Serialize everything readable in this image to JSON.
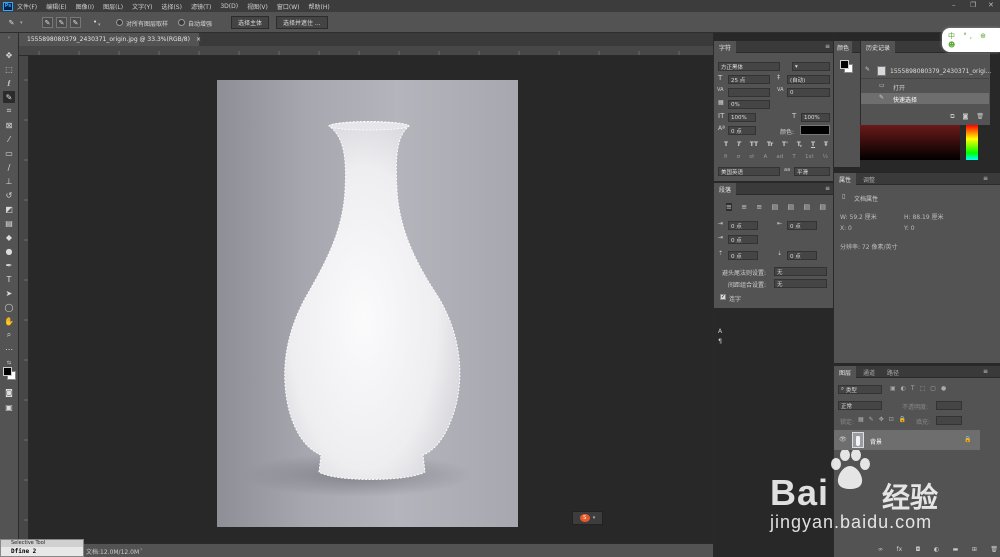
{
  "menu": {
    "logo": "Ps",
    "items": [
      "文件(F)",
      "编辑(E)",
      "图像(I)",
      "图层(L)",
      "文字(Y)",
      "选择(S)",
      "滤镜(T)",
      "3D(D)",
      "视图(V)",
      "窗口(W)",
      "帮助(H)"
    ]
  },
  "options": {
    "sample_all_layers": "对所有图层取样",
    "auto_enhance": "自动增强",
    "select_subject": "选择主体",
    "select_and_mask": "选择并遮住 ..."
  },
  "document": {
    "tab_title": "1555898080379_2430371_origin.jpg @ 33.3%(RGB/8)",
    "tab_close": "×"
  },
  "status": {
    "doc_size": "文档:12.0M/12.0M"
  },
  "character_panel": {
    "tab": "字符",
    "font_family": "方正黑体",
    "font_size": "25 点",
    "leading": "(自动)",
    "tracking": "0",
    "scale_pct": "0%",
    "v_scale": "100%",
    "h_scale": "100%",
    "baseline": "0 点",
    "color_label": "颜色:",
    "language": "美国英语",
    "antialias": "平滑",
    "style_buttons": [
      "T",
      "T",
      "TT",
      "Tr",
      "T'",
      "T,",
      "T",
      "Ŧ"
    ],
    "ot_buttons": [
      "fi",
      "σ",
      "st",
      "A",
      "ad",
      "T",
      "1st",
      "½"
    ]
  },
  "paragraph_panel": {
    "tab": "段落",
    "indent_left": "0 点",
    "indent_right": "0 点",
    "indent_first": "0 点",
    "space_before": "0 点",
    "space_after": "0 点",
    "kinsoku_label": "避头尾法则设置:",
    "kinsoku_value": "无",
    "mojikumi_label": "间距组合设置:",
    "mojikumi_value": "无",
    "hyphenate": "连字"
  },
  "color_panel": {
    "tab": "颜色"
  },
  "history_panel": {
    "tab": "历史记录",
    "snapshot": "1555898080379_2430371_origi...",
    "steps": [
      "打开",
      "快速选择"
    ]
  },
  "properties_panel": {
    "tab": "属性",
    "tab2": "调整",
    "title": "文档属性",
    "width": "W:  59.2 厘米",
    "height": "H:  88.19 厘米",
    "x": "X:  0",
    "y": "Y:  0",
    "resolution": "分辨率: 72 像素/英寸"
  },
  "layers_panel": {
    "tabs": [
      "图层",
      "通道",
      "路径"
    ],
    "kind_label": "类型",
    "blend_mode": "正常",
    "opacity_label": "不透明度:",
    "lock_label": "锁定:",
    "fill_label": "填充:",
    "layer_name": "背景"
  },
  "ime": {
    "text": "中 °, ⊕ ☻"
  },
  "floating_widget": {
    "label": "S"
  },
  "tooltip": {
    "title": "Selective Tool",
    "body": "Dfine 2"
  },
  "watermark": {
    "brand": "Bai",
    "brand2": "经验",
    "url": "jingyan.baidu.com"
  },
  "colors": {
    "ui_dark": "#3c3c3c",
    "ui_mid": "#535353",
    "canvas_bg": "#282828",
    "selection": "#ffffff"
  }
}
